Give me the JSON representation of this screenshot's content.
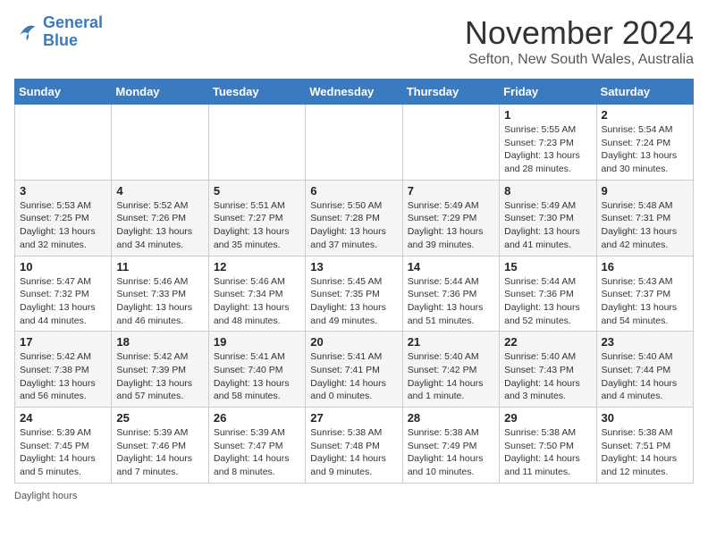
{
  "header": {
    "logo_line1": "General",
    "logo_line2": "Blue",
    "month": "November 2024",
    "location": "Sefton, New South Wales, Australia"
  },
  "weekdays": [
    "Sunday",
    "Monday",
    "Tuesday",
    "Wednesday",
    "Thursday",
    "Friday",
    "Saturday"
  ],
  "weeks": [
    [
      {
        "day": "",
        "info": ""
      },
      {
        "day": "",
        "info": ""
      },
      {
        "day": "",
        "info": ""
      },
      {
        "day": "",
        "info": ""
      },
      {
        "day": "",
        "info": ""
      },
      {
        "day": "1",
        "info": "Sunrise: 5:55 AM\nSunset: 7:23 PM\nDaylight: 13 hours\nand 28 minutes."
      },
      {
        "day": "2",
        "info": "Sunrise: 5:54 AM\nSunset: 7:24 PM\nDaylight: 13 hours\nand 30 minutes."
      }
    ],
    [
      {
        "day": "3",
        "info": "Sunrise: 5:53 AM\nSunset: 7:25 PM\nDaylight: 13 hours\nand 32 minutes."
      },
      {
        "day": "4",
        "info": "Sunrise: 5:52 AM\nSunset: 7:26 PM\nDaylight: 13 hours\nand 34 minutes."
      },
      {
        "day": "5",
        "info": "Sunrise: 5:51 AM\nSunset: 7:27 PM\nDaylight: 13 hours\nand 35 minutes."
      },
      {
        "day": "6",
        "info": "Sunrise: 5:50 AM\nSunset: 7:28 PM\nDaylight: 13 hours\nand 37 minutes."
      },
      {
        "day": "7",
        "info": "Sunrise: 5:49 AM\nSunset: 7:29 PM\nDaylight: 13 hours\nand 39 minutes."
      },
      {
        "day": "8",
        "info": "Sunrise: 5:49 AM\nSunset: 7:30 PM\nDaylight: 13 hours\nand 41 minutes."
      },
      {
        "day": "9",
        "info": "Sunrise: 5:48 AM\nSunset: 7:31 PM\nDaylight: 13 hours\nand 42 minutes."
      }
    ],
    [
      {
        "day": "10",
        "info": "Sunrise: 5:47 AM\nSunset: 7:32 PM\nDaylight: 13 hours\nand 44 minutes."
      },
      {
        "day": "11",
        "info": "Sunrise: 5:46 AM\nSunset: 7:33 PM\nDaylight: 13 hours\nand 46 minutes."
      },
      {
        "day": "12",
        "info": "Sunrise: 5:46 AM\nSunset: 7:34 PM\nDaylight: 13 hours\nand 48 minutes."
      },
      {
        "day": "13",
        "info": "Sunrise: 5:45 AM\nSunset: 7:35 PM\nDaylight: 13 hours\nand 49 minutes."
      },
      {
        "day": "14",
        "info": "Sunrise: 5:44 AM\nSunset: 7:36 PM\nDaylight: 13 hours\nand 51 minutes."
      },
      {
        "day": "15",
        "info": "Sunrise: 5:44 AM\nSunset: 7:36 PM\nDaylight: 13 hours\nand 52 minutes."
      },
      {
        "day": "16",
        "info": "Sunrise: 5:43 AM\nSunset: 7:37 PM\nDaylight: 13 hours\nand 54 minutes."
      }
    ],
    [
      {
        "day": "17",
        "info": "Sunrise: 5:42 AM\nSunset: 7:38 PM\nDaylight: 13 hours\nand 56 minutes."
      },
      {
        "day": "18",
        "info": "Sunrise: 5:42 AM\nSunset: 7:39 PM\nDaylight: 13 hours\nand 57 minutes."
      },
      {
        "day": "19",
        "info": "Sunrise: 5:41 AM\nSunset: 7:40 PM\nDaylight: 13 hours\nand 58 minutes."
      },
      {
        "day": "20",
        "info": "Sunrise: 5:41 AM\nSunset: 7:41 PM\nDaylight: 14 hours\nand 0 minutes."
      },
      {
        "day": "21",
        "info": "Sunrise: 5:40 AM\nSunset: 7:42 PM\nDaylight: 14 hours\nand 1 minute."
      },
      {
        "day": "22",
        "info": "Sunrise: 5:40 AM\nSunset: 7:43 PM\nDaylight: 14 hours\nand 3 minutes."
      },
      {
        "day": "23",
        "info": "Sunrise: 5:40 AM\nSunset: 7:44 PM\nDaylight: 14 hours\nand 4 minutes."
      }
    ],
    [
      {
        "day": "24",
        "info": "Sunrise: 5:39 AM\nSunset: 7:45 PM\nDaylight: 14 hours\nand 5 minutes."
      },
      {
        "day": "25",
        "info": "Sunrise: 5:39 AM\nSunset: 7:46 PM\nDaylight: 14 hours\nand 7 minutes."
      },
      {
        "day": "26",
        "info": "Sunrise: 5:39 AM\nSunset: 7:47 PM\nDaylight: 14 hours\nand 8 minutes."
      },
      {
        "day": "27",
        "info": "Sunrise: 5:38 AM\nSunset: 7:48 PM\nDaylight: 14 hours\nand 9 minutes."
      },
      {
        "day": "28",
        "info": "Sunrise: 5:38 AM\nSunset: 7:49 PM\nDaylight: 14 hours\nand 10 minutes."
      },
      {
        "day": "29",
        "info": "Sunrise: 5:38 AM\nSunset: 7:50 PM\nDaylight: 14 hours\nand 11 minutes."
      },
      {
        "day": "30",
        "info": "Sunrise: 5:38 AM\nSunset: 7:51 PM\nDaylight: 14 hours\nand 12 minutes."
      }
    ]
  ],
  "footer": {
    "daylight_label": "Daylight hours"
  }
}
